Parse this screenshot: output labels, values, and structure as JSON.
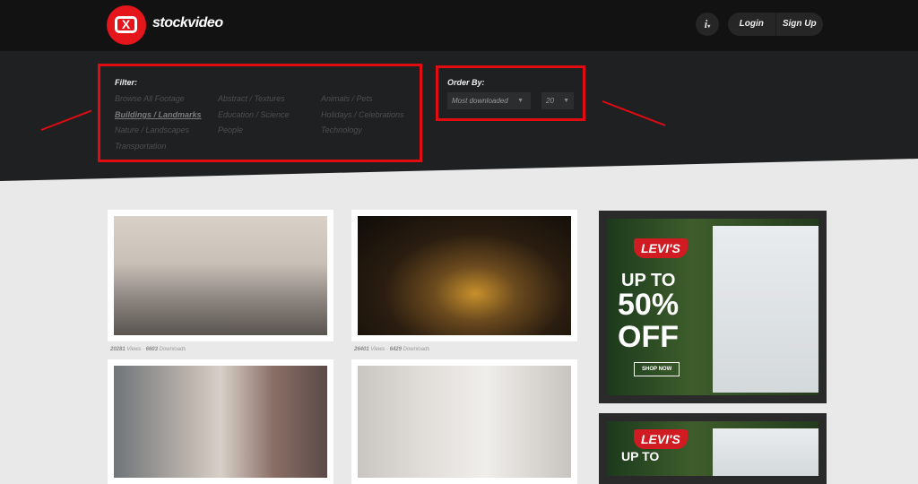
{
  "header": {
    "logo_text": "stockvideo",
    "logo_glyph": "X",
    "info_label": "i",
    "login": "Login",
    "signup": "Sign Up"
  },
  "filter": {
    "label": "Filter:",
    "items": [
      "Browse All Footage",
      "Abstract / Textures",
      "Animals / Pets",
      "Buildings / Landmarks",
      "Education / Science",
      "Holidays / Celebrations",
      "Nature / Landscapes",
      "People",
      "Technology",
      "Transportation"
    ],
    "active": "Buildings / Landmarks"
  },
  "order": {
    "label": "Order By:",
    "sort_value": "Most downloaded",
    "count_value": "20"
  },
  "videos": [
    {
      "views": "20281",
      "views_label": "Views",
      "downloads": "6603",
      "downloads_label": "Downloads"
    },
    {
      "views": "26401",
      "views_label": "Views",
      "downloads": "6429",
      "downloads_label": "Downloads"
    }
  ],
  "ad": {
    "brand": "LEVI'S",
    "headline": "UP TO",
    "discount": "50%",
    "off": "OFF",
    "cta": "SHOP NOW"
  },
  "colors": {
    "accent": "#e10b12",
    "header": "#121212",
    "filterbar": "#1f2021"
  }
}
